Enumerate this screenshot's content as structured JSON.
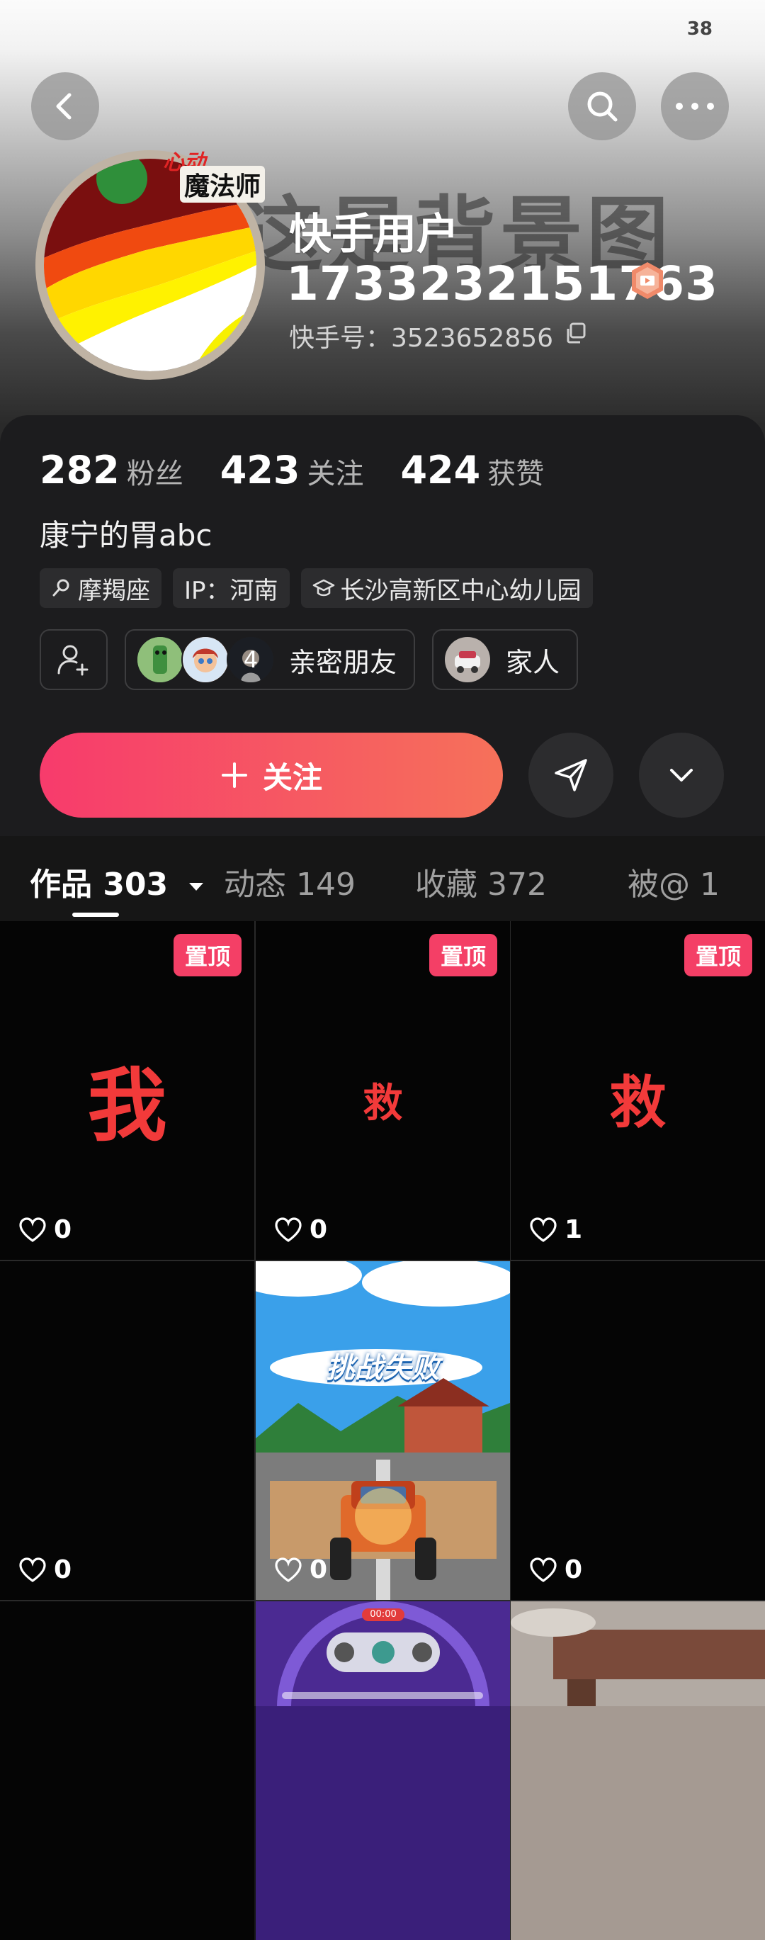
{
  "status": {
    "time": "",
    "battery": "38"
  },
  "header": {
    "background_text": "这是背景图",
    "avatar_badge_line1": "心动",
    "avatar_badge_line2": "魔法师",
    "username": "快手用户",
    "user_number": "1733232151763",
    "kuaishou_id": "快手号：3523652856"
  },
  "stats": [
    {
      "value": "282",
      "label": "粉丝"
    },
    {
      "value": "423",
      "label": "关注"
    },
    {
      "value": "424",
      "label": "获赞"
    }
  ],
  "bio": "康宁的胃abc",
  "tags": [
    {
      "icon": "zodiac-icon",
      "text": "摩羯座"
    },
    {
      "icon": "",
      "text": "IP：河南"
    },
    {
      "icon": "school-icon",
      "text": "长沙高新区中心幼儿园"
    }
  ],
  "circles": {
    "friends_count": "4",
    "friends_label": "亲密朋友",
    "family_label": "家人"
  },
  "actions": {
    "follow_label": "关注"
  },
  "tabs": [
    {
      "label": "作品 303",
      "active": true
    },
    {
      "label": "动态 149",
      "active": false
    },
    {
      "label": "收藏 372",
      "active": false
    },
    {
      "label": "被@ 1",
      "active": false
    }
  ],
  "grid": [
    {
      "pinned": true,
      "pin_label": "置顶",
      "text": "我",
      "likes": "0"
    },
    {
      "pinned": true,
      "pin_label": "置顶",
      "text": "救",
      "likes": "0"
    },
    {
      "pinned": true,
      "pin_label": "置顶",
      "text": "救",
      "likes": "1"
    },
    {
      "pinned": false,
      "text": "",
      "likes": "0"
    },
    {
      "pinned": false,
      "text": "挑战失败",
      "likes": "0"
    },
    {
      "pinned": false,
      "text": "",
      "likes": "0"
    },
    {
      "pinned": false,
      "text": "",
      "likes": ""
    },
    {
      "pinned": false,
      "text": "00:00",
      "likes": ""
    },
    {
      "pinned": false,
      "text": "",
      "likes": ""
    }
  ],
  "colors": {
    "accent_start": "#f73b6c",
    "accent_end": "#f6715a",
    "pin": "#f43f66",
    "panel": "#1c1c1e"
  }
}
